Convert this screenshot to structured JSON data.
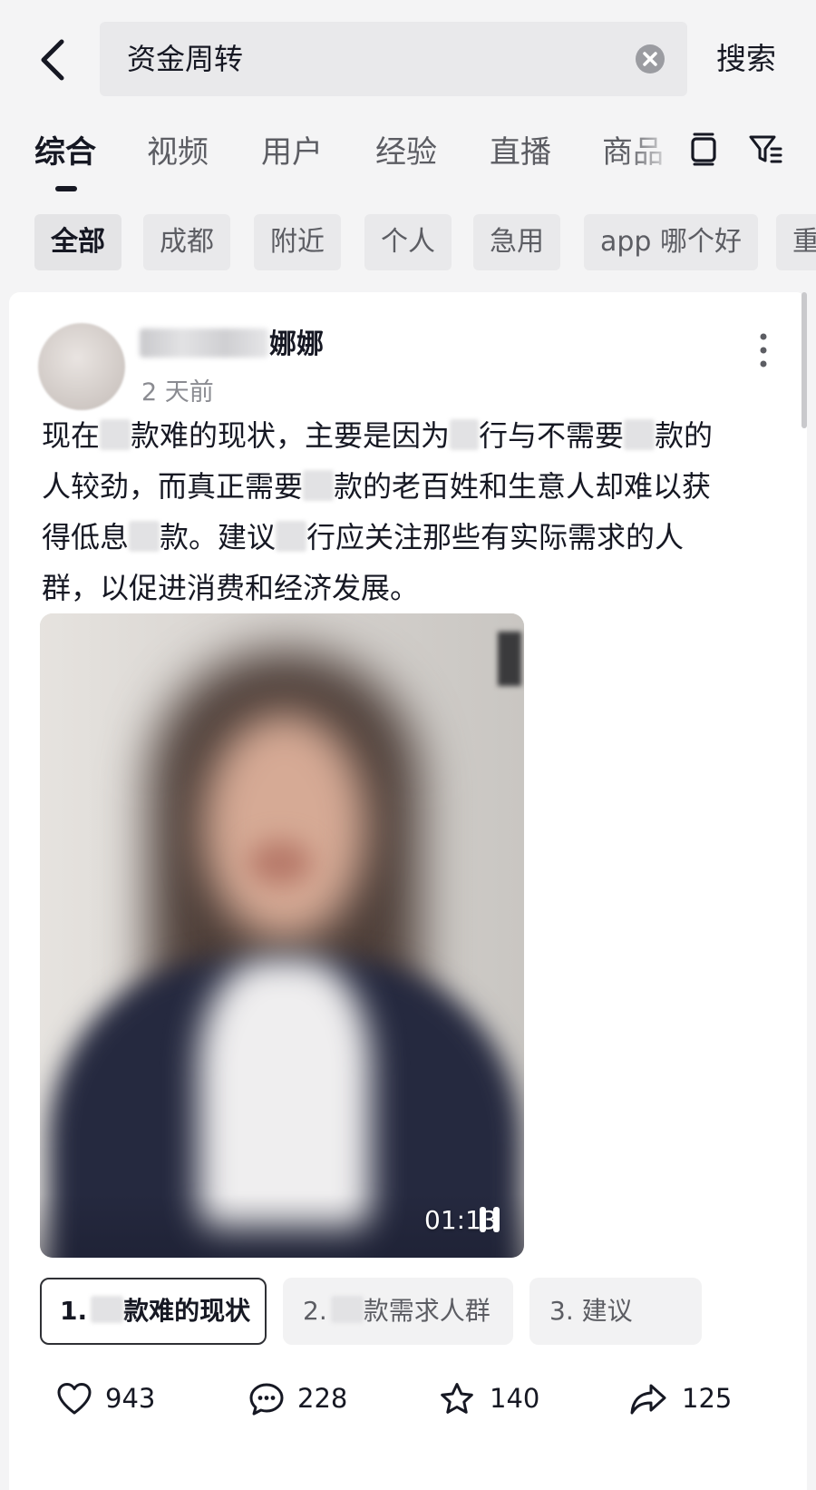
{
  "search": {
    "query": "资金周转",
    "button_label": "搜索"
  },
  "tabs": [
    {
      "label": "综合",
      "active": true
    },
    {
      "label": "视频"
    },
    {
      "label": "用户"
    },
    {
      "label": "经验"
    },
    {
      "label": "直播"
    },
    {
      "label": "商品"
    }
  ],
  "chips": [
    {
      "label": "全部",
      "active": true
    },
    {
      "label": "成都"
    },
    {
      "label": "附近"
    },
    {
      "label": "个人"
    },
    {
      "label": "急用"
    },
    {
      "label": "app 哪个好"
    },
    {
      "label": "重"
    }
  ],
  "post": {
    "author": "娜娜",
    "time": "2 天前",
    "lines": {
      "l1a": "现在",
      "l1b": "款难的现状，主要是因为",
      "l1c": "行与不需要",
      "l1d": "款的",
      "l2a": "人较劲，而真正需要",
      "l2b": "款的老百姓和生意人却难以获",
      "l3a": "得低息",
      "l3b": "款。建议",
      "l3c": "行应关注那些有实际需求的人",
      "l4a": "群，以促进消费和经济发展。"
    },
    "video": {
      "duration": "01:13"
    },
    "chapters": [
      {
        "prefix": "1.",
        "suffix": "款难的现状",
        "active": true
      },
      {
        "prefix": "2.",
        "suffix": "款需求人群"
      },
      {
        "prefix": "3. 建议",
        "suffix": ""
      }
    ],
    "stats": {
      "likes": "943",
      "comments": "228",
      "favorites": "140",
      "shares": "125"
    }
  },
  "icons": {
    "back": "chevron-left-icon",
    "clear": "clear-circle-icon",
    "layout": "layout-toggle-icon",
    "filter": "filter-icon",
    "more": "more-vertical-icon",
    "pause": "pause-icon",
    "like": "heart-icon",
    "comment": "comment-bubble-icon",
    "favorite": "star-icon",
    "share": "share-arrow-icon"
  },
  "colors": {
    "background": "#f4f4f5",
    "text": "#161823",
    "secondary_text": "#8a8b91"
  }
}
